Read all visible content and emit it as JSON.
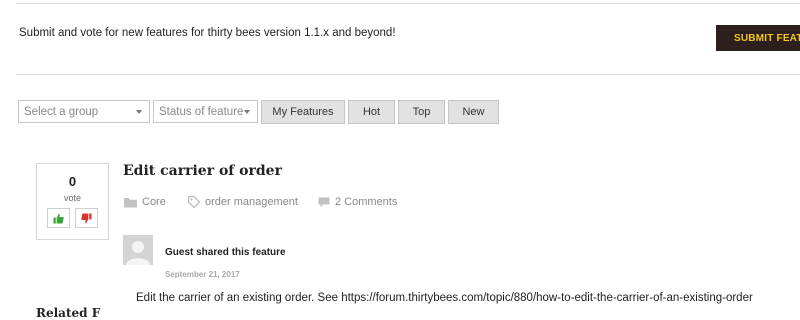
{
  "header": {
    "intro_text": "Submit and vote for new features for thirty bees version 1.1.x and beyond!",
    "submit_label": "SUBMIT FEATUR"
  },
  "filters": {
    "group_placeholder": "Select a group",
    "status_placeholder": "Status of feature",
    "buttons": [
      "My Features",
      "Hot",
      "Top",
      "New"
    ]
  },
  "feature": {
    "vote_count": "0",
    "vote_label": "vote",
    "title": "Edit carrier of order",
    "category": "Core",
    "tag": "order management",
    "comments": "2 Comments",
    "author_line": "Guest shared this feature",
    "date": "September 21, 2017",
    "description": "Edit the carrier of an existing order. See https://forum.thirtybees.com/topic/880/how-to-edit-the-carrier-of-an-existing-order"
  },
  "partial_heading": "Related F",
  "icons": [
    "folder-icon",
    "tag-icon",
    "comment-icon",
    "thumbs-up-icon",
    "thumbs-down-icon",
    "avatar-placeholder-icon",
    "chevron-down-icon"
  ],
  "colors": {
    "submit_bg": "#2c1f1d",
    "submit_text": "#f6c620",
    "upvote": "#3aa53a",
    "downvote": "#d9342b"
  }
}
